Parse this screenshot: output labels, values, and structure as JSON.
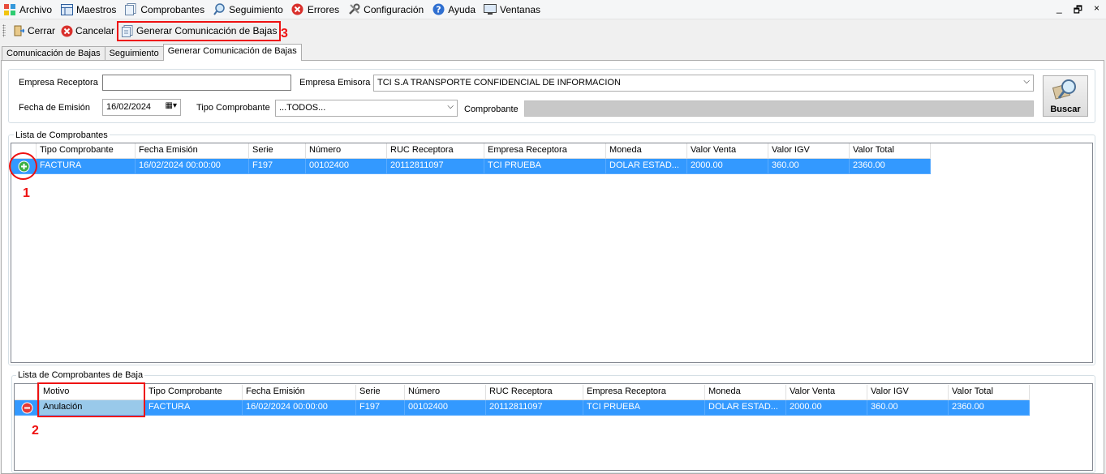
{
  "menu": [
    {
      "label": "Archivo",
      "icon": "app-grid-icon"
    },
    {
      "label": "Maestros",
      "icon": "table-icon"
    },
    {
      "label": "Comprobantes",
      "icon": "documents-icon"
    },
    {
      "label": "Seguimiento",
      "icon": "magnifier-icon"
    },
    {
      "label": "Errores",
      "icon": "error-icon"
    },
    {
      "label": "Configuración",
      "icon": "tools-icon"
    },
    {
      "label": "Ayuda",
      "icon": "help-icon"
    },
    {
      "label": "Ventanas",
      "icon": "monitor-icon"
    }
  ],
  "window_controls": {
    "minimize": "_",
    "restore": "🗗",
    "close": "×"
  },
  "toolbar": {
    "cerrar": "Cerrar",
    "cancelar": "Cancelar",
    "generar": "Generar Comunicación de Bajas"
  },
  "tabs": [
    "Comunicación de Bajas",
    "Seguimiento",
    "Generar Comunicación de Bajas"
  ],
  "filters": {
    "empresa_receptora_label": "Empresa Receptora",
    "empresa_receptora_value": "",
    "empresa_emisora_label": "Empresa Emisora",
    "empresa_emisora_value": "TCI S.A TRANSPORTE CONFIDENCIAL DE INFORMACION",
    "fecha_emision_label": "Fecha de Emisión",
    "fecha_emision_value": "16/02/2024",
    "tipo_comprobante_label": "Tipo Comprobante",
    "tipo_comprobante_value": "...TODOS...",
    "comprobante_label": "Comprobante",
    "comprobante_value": "",
    "buscar_label": "Buscar"
  },
  "lista_comprobantes": {
    "title": "Lista de Comprobantes",
    "columns": [
      "Tipo Comprobante",
      "Fecha Emisión",
      "Serie",
      "Número",
      "RUC Receptora",
      "Empresa Receptora",
      "Moneda",
      "Valor Venta",
      "Valor IGV",
      "Valor Total"
    ],
    "rows": [
      [
        "FACTURA",
        "16/02/2024 00:00:00",
        "F197",
        "00102400",
        "20112811097",
        "TCI PRUEBA",
        "DOLAR ESTAD...",
        "2000.00",
        "360.00",
        "2360.00"
      ]
    ]
  },
  "lista_bajas": {
    "title": "Lista de Comprobantes de Baja",
    "columns": [
      "Motivo",
      "Tipo Comprobante",
      "Fecha Emisión",
      "Serie",
      "Número",
      "RUC Receptora",
      "Empresa Receptora",
      "Moneda",
      "Valor Venta",
      "Valor IGV",
      "Valor Total"
    ],
    "rows": [
      [
        "Anulación",
        "FACTURA",
        "16/02/2024 00:00:00",
        "F197",
        "00102400",
        "20112811097",
        "TCI PRUEBA",
        "DOLAR ESTAD...",
        "2000.00",
        "360.00",
        "2360.00"
      ]
    ]
  },
  "annotations": [
    "1",
    "2",
    "3"
  ],
  "colors": {
    "selection": "#3399ff",
    "annotation": "#e11111",
    "add_icon": "#3cb043",
    "remove_icon": "#e53935"
  }
}
